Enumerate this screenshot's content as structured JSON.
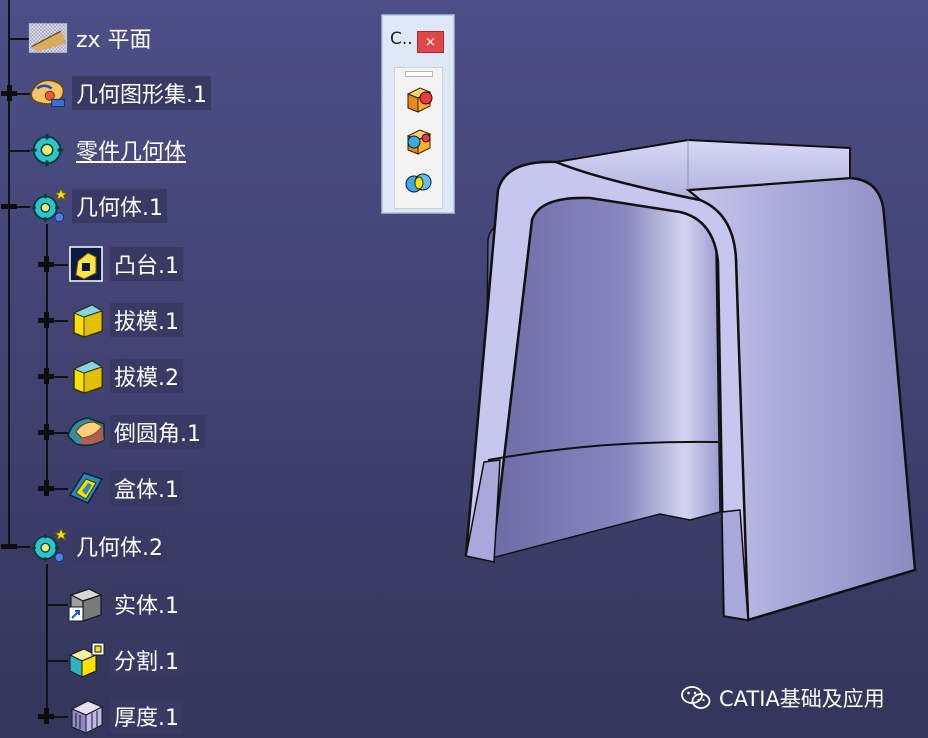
{
  "tree": {
    "items": [
      {
        "label": "zx 平面",
        "icon": "plane-icon"
      },
      {
        "label": "几何图形集.1",
        "icon": "geometrical-set-icon"
      },
      {
        "label": "零件几何体",
        "icon": "part-body-icon"
      },
      {
        "label": "几何体.1",
        "icon": "body-icon"
      },
      {
        "label": "凸台.1",
        "icon": "pad-icon"
      },
      {
        "label": "拔模.1",
        "icon": "draft-icon"
      },
      {
        "label": "拔模.2",
        "icon": "draft-icon"
      },
      {
        "label": "倒圆角.1",
        "icon": "edge-fillet-icon"
      },
      {
        "label": "盒体.1",
        "icon": "shell-icon"
      },
      {
        "label": "几何体.2",
        "icon": "body-icon"
      },
      {
        "label": "实体.1",
        "icon": "solid-icon"
      },
      {
        "label": "分割.1",
        "icon": "split-icon"
      },
      {
        "label": "厚度.1",
        "icon": "thickness-icon"
      }
    ]
  },
  "toolbar": {
    "title": "C..",
    "close_label": "×",
    "buttons": [
      "boolean-add-icon",
      "boolean-remove-icon",
      "boolean-intersect-icon"
    ]
  },
  "watermark": {
    "text": "CATIA基础及应用",
    "icon": "wechat-icon"
  },
  "colors": {
    "background": "#44477a",
    "label_bg": "#383a64",
    "model_face": "#b9b9e0",
    "model_edge": "#111111"
  }
}
